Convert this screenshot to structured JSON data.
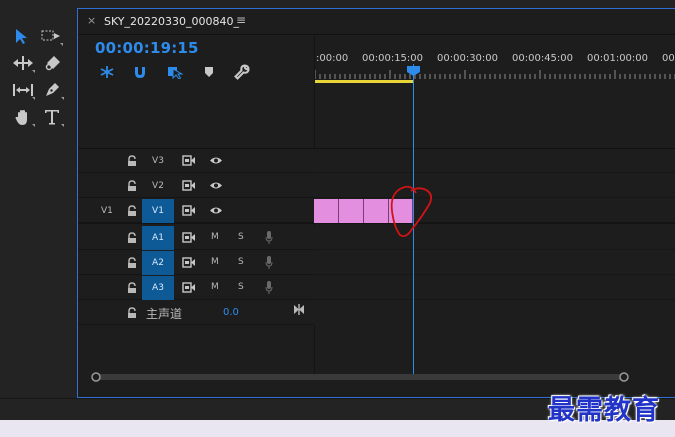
{
  "panel": {
    "tab_title": "SKY_20220330_000840_",
    "tab_close": "×",
    "tab_menu": "≡",
    "timecode": "00:00:19:15"
  },
  "ruler": {
    "ticks": [
      ":00:00",
      "00:00:15:00",
      "00:00:30:00",
      "00:00:45:00",
      "00:01:00:00",
      "00"
    ]
  },
  "tools": [
    "selection-tool",
    "track-select-forward-tool",
    "ripple-edit-tool",
    "razor-tool",
    "slip-tool",
    "pen-tool",
    "hand-tool",
    "type-tool"
  ],
  "video_tracks": [
    {
      "source": "",
      "name": "V3",
      "targeted": false
    },
    {
      "source": "",
      "name": "V2",
      "targeted": false
    },
    {
      "source": "V1",
      "name": "V1",
      "targeted": true
    }
  ],
  "audio_tracks": [
    {
      "name": "A1",
      "mute": "M",
      "solo": "S"
    },
    {
      "name": "A2",
      "mute": "M",
      "solo": "S"
    },
    {
      "name": "A3",
      "mute": "M",
      "solo": "S"
    }
  ],
  "master": {
    "label": "主声道",
    "value": "0.0"
  },
  "watermark": "最需教育",
  "colors": {
    "accent": "#2d8ceb",
    "clip": "#e48ee0",
    "target": "#0e5a97",
    "annotation": "#d01414"
  }
}
